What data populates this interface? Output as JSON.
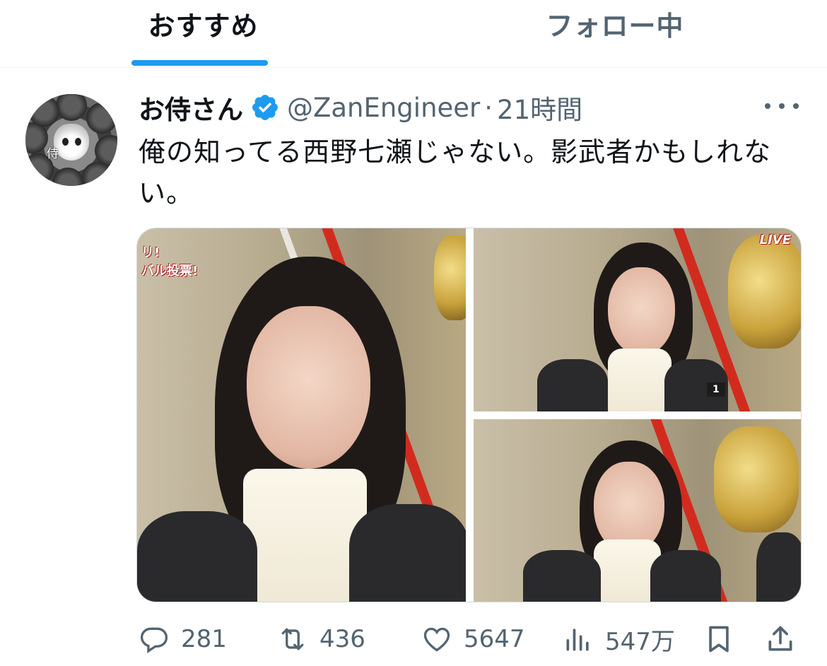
{
  "tabs": [
    {
      "label": "おすすめ",
      "active": true
    },
    {
      "label": "フォロー中",
      "active": false
    }
  ],
  "accent_color": "#1d9bf0",
  "tweet": {
    "avatar_text": "侍",
    "display_name": "お侍さん",
    "verified": true,
    "handle": "@ZanEngineer",
    "separator": "·",
    "time": "21時間",
    "text": "俺の知ってる西野七瀬じゃない。影武者かもしれない。",
    "media": [
      {
        "caption": "リ!\nバル投票!"
      },
      {
        "caption": "LIVE",
        "score_label": "1"
      },
      {
        "caption": ""
      }
    ],
    "actions": {
      "reply": {
        "icon": "reply-icon",
        "count": "281"
      },
      "retweet": {
        "icon": "retweet-icon",
        "count": "436"
      },
      "like": {
        "icon": "heart-icon",
        "count": "5647"
      },
      "views": {
        "icon": "views-icon",
        "count": "547万"
      },
      "bookmark": {
        "icon": "bookmark-icon"
      },
      "share": {
        "icon": "share-icon"
      }
    }
  }
}
